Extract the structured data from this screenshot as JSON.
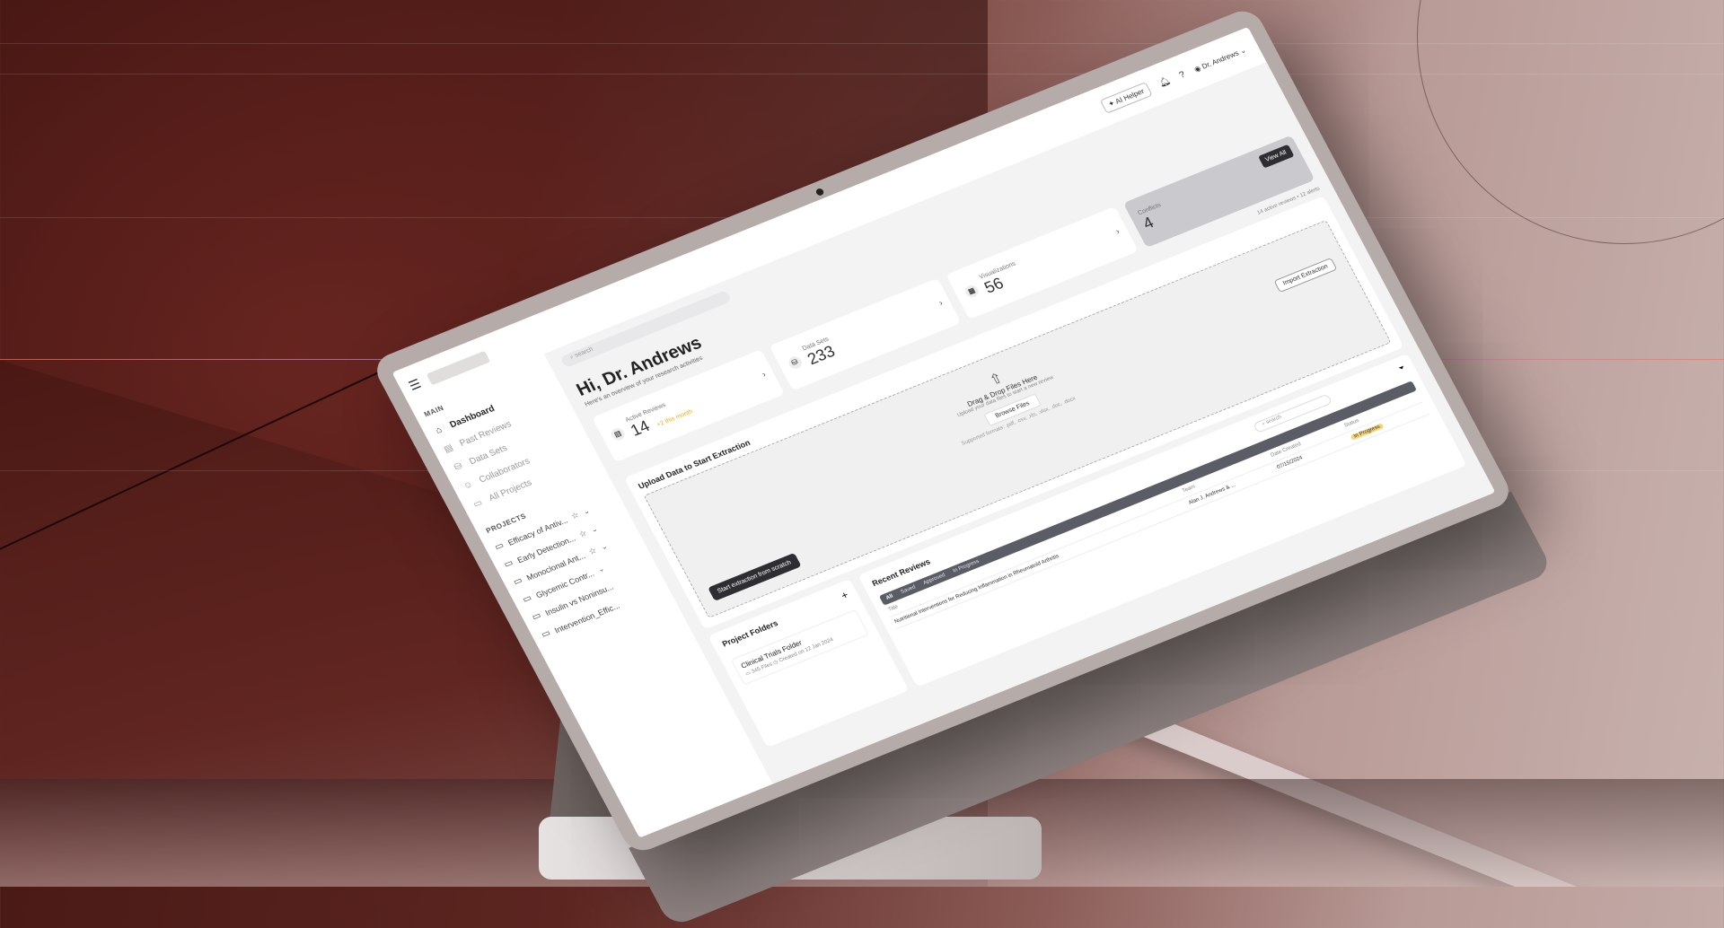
{
  "app": {
    "user_name": "Dr. Andrews",
    "ai_helper_label": "AI Helper",
    "search_placeholder": "search"
  },
  "sidebar": {
    "main_label": "MAIN",
    "items": [
      {
        "label": "Dashboard",
        "icon": "home-icon"
      },
      {
        "label": "Past Reviews",
        "icon": "document-icon"
      },
      {
        "label": "Data Sets",
        "icon": "database-icon"
      },
      {
        "label": "Collaborators",
        "icon": "users-icon"
      },
      {
        "label": "All Projects",
        "icon": "folder-icon"
      }
    ],
    "projects_label": "PROJECTS",
    "projects": [
      {
        "label": "Efficacy of Antiv..."
      },
      {
        "label": "Early Detection..."
      },
      {
        "label": "Monoclonal Ant..."
      },
      {
        "label": "Glycemic Contr..."
      },
      {
        "label": "Insulin vs Noninsu..."
      },
      {
        "label": "Intervention_Effic..."
      }
    ]
  },
  "header": {
    "greeting": "Hi, Dr. Andrews",
    "subtitle": "Here's an overview of your research activities"
  },
  "stats": [
    {
      "label": "Active Reviews",
      "value": "14",
      "delta": "+2 this month",
      "icon": "document-icon"
    },
    {
      "label": "Data Sets",
      "value": "233",
      "delta": "",
      "icon": "database-icon"
    },
    {
      "label": "Visualizations",
      "value": "56",
      "delta": "",
      "icon": "presentation-icon"
    },
    {
      "label": "Conflicts",
      "value": "4",
      "delta": "",
      "button": "View All"
    }
  ],
  "alerts": "14 active reviews  •  12 alerts",
  "upload": {
    "title": "Upload Data to Start Extraction",
    "drop_title": "Drag & Drop Files Here",
    "drop_sub": "Upload your data files to start a new review",
    "browse_label": "Browse Files",
    "formats": "Supported formats: .pdf, .csv, .xls, .xlsx, .doc, .docx",
    "import_label": "Import Extraction",
    "scratch_label": "Start extraction from scratch"
  },
  "folders": {
    "title": "Project Folders",
    "card_title": "Clinical Trials Folder",
    "card_files": "345 Files",
    "card_created": "Created on 12 Jan 2024"
  },
  "reviews": {
    "title": "Recent Reviews",
    "search_placeholder": "search",
    "tabs": [
      "All",
      "Saved",
      "Approved",
      "In Progress"
    ],
    "columns": [
      "Title",
      "Team",
      "Date Created",
      "Status"
    ],
    "rows": [
      {
        "title": "Nutritional Interventions for Reducing Inflammation in Rheumatoid Arthritis",
        "team": "Alan J. Andrews & ...",
        "date": "07/15/2024",
        "status": "In Progress"
      }
    ]
  }
}
